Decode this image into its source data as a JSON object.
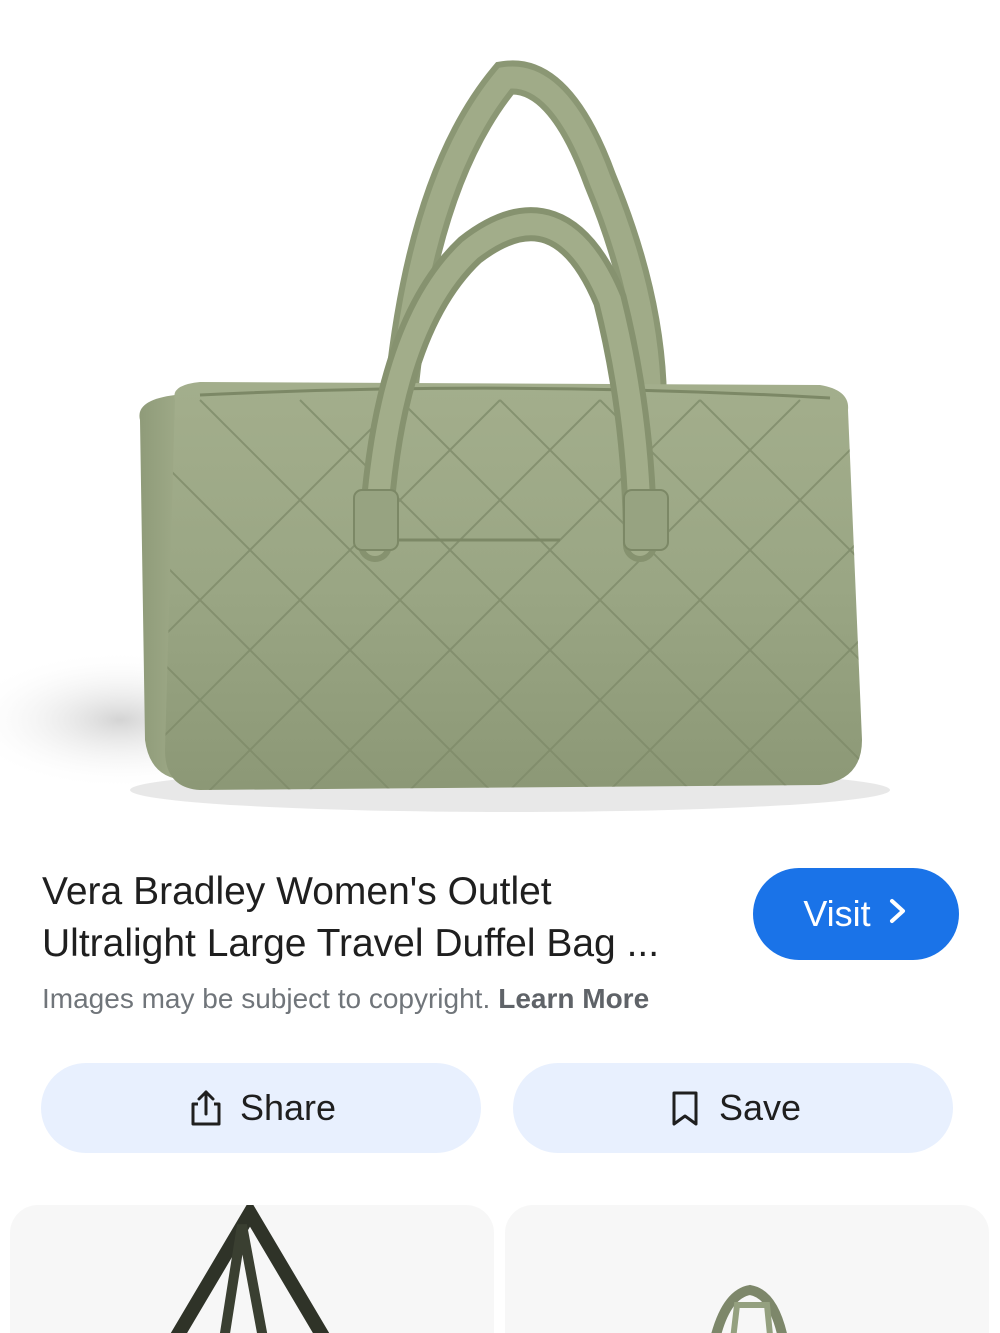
{
  "product": {
    "title_line1": "Vera Bradley Women's Outlet",
    "title_line2": "Ultralight Large Travel Duffel Bag ...",
    "image_icon": "quilted-duffel-bag-image"
  },
  "visit_button": {
    "label": "Visit",
    "chevron": "›",
    "color": "#1a73e8"
  },
  "copyright": {
    "text": "Images may be subject to copyright.",
    "link": "Learn More"
  },
  "actions": {
    "share_label": "Share",
    "share_icon": "share-icon",
    "save_label": "Save",
    "save_icon": "bookmark-icon",
    "button_color": "#e8f0fe"
  },
  "related": {
    "thumb_icons": [
      "related-bag-image-1",
      "related-bag-image-2"
    ]
  }
}
